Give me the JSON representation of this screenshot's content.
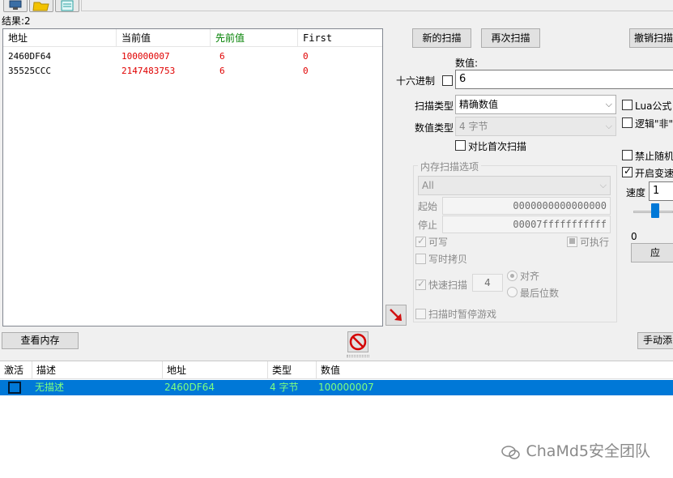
{
  "results_label": "结果:2",
  "result_list": {
    "columns": [
      "地址",
      "当前值",
      "先前值",
      "First"
    ],
    "rows": [
      {
        "address": "2460DF64",
        "current": "100000007",
        "previous": "6",
        "first": "0"
      },
      {
        "address": "35525CCC",
        "current": "2147483753",
        "previous": "6",
        "first": "0"
      }
    ]
  },
  "buttons": {
    "new_scan": "新的扫描",
    "next_scan": "再次扫描",
    "undo_scan": "撤销扫描",
    "view_memory": "查看内存",
    "add_manual": "手动添",
    "apply": "应"
  },
  "value_section": {
    "value_label": "数值:",
    "hex_label": "十六进制",
    "value": "6"
  },
  "scan_type": {
    "label": "扫描类型",
    "selected": "精确数值"
  },
  "value_type": {
    "label": "数值类型",
    "selected": "4 字节"
  },
  "compare_first_label": "对比首次扫描",
  "memory_options": {
    "title": "内存扫描选项",
    "region": "All",
    "start_label": "起始",
    "start_value": "0000000000000000",
    "stop_label": "停止",
    "stop_value": "00007fffffffffff",
    "writable_label": "可写",
    "executable_label": "可执行",
    "copy_on_write_label": "写时拷贝",
    "fast_scan_label": "快速扫描",
    "fast_scan_value": "4",
    "align_label": "对齐",
    "last_digits_label": "最后位数",
    "pause_label": "扫描时暂停游戏"
  },
  "right_options": {
    "lua_label": "Lua公式",
    "not_label": "逻辑\"非\"",
    "no_random_label": "禁止随机",
    "speedhack_label": "开启变速",
    "speed_label": "速度",
    "speed_value": "1",
    "slider_min": "0"
  },
  "address_list": {
    "columns": [
      "激活",
      "描述",
      "地址",
      "类型",
      "数值"
    ],
    "rows": [
      {
        "description": "无描述",
        "address": "2460DF64",
        "type": "4 字节",
        "value": "100000007"
      }
    ]
  },
  "watermark": "ChaMd5安全团队",
  "colors": {
    "current_value": "#e00000",
    "previous_header": "#008000",
    "selection": "#0078d7",
    "selection_text": "#7fff7f",
    "stop_icon": "#d40000",
    "arrow": "#d01010"
  }
}
